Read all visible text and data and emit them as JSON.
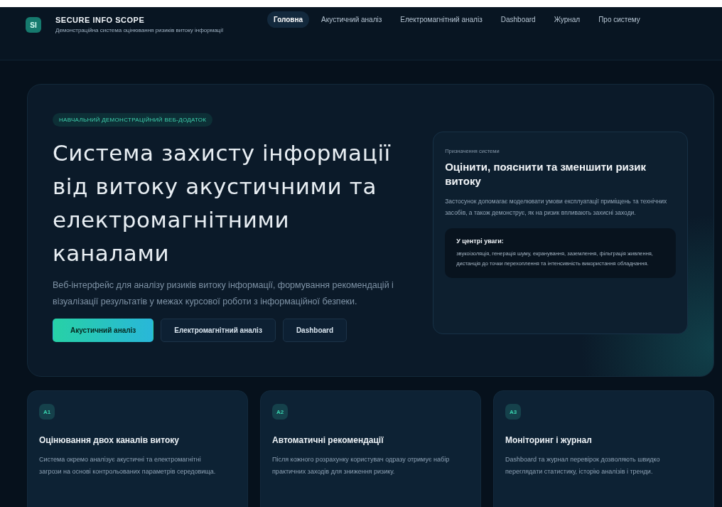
{
  "header": {
    "logo": "SI",
    "title": "SECURE INFO SCOPE",
    "subtitle": "Демонстраційна система оцінювання ризиків витоку інформації"
  },
  "nav": [
    {
      "label": "Головна",
      "selected": true
    },
    {
      "label": "Акустичний аналіз",
      "selected": false
    },
    {
      "label": "Електромагнітний аналіз",
      "selected": false
    },
    {
      "label": "Dashboard",
      "selected": false
    },
    {
      "label": "Журнал",
      "selected": false
    },
    {
      "label": "Про систему",
      "selected": false
    }
  ],
  "hero": {
    "badge": "НАВЧАЛЬНИЙ ДЕМОНСТРАЦІЙНИЙ ВЕБ-ДОДАТОК",
    "title": "Система захисту інформації від витоку акустичними та електромагнітними каналами",
    "description": "Веб-інтерфейс для аналізу ризиків витоку інформації, формування рекомендацій і візуалізації результатів у межах курсової роботи з інформаційної безпеки.",
    "buttons": [
      {
        "label": "Акустичний аналіз",
        "kind": "primary"
      },
      {
        "label": "Електромагнітний аналіз",
        "kind": "secondary"
      },
      {
        "label": "Dashboard",
        "kind": "secondary"
      }
    ]
  },
  "purpose_card": {
    "eyebrow": "Призначення системи",
    "title": "Оцінити, пояснити та зменшити ризик витоку",
    "text": "Застосунок допомагає моделювати умови експлуатації приміщень та технічних засобів, а також демонструє, як на ризик впливають захисні заходи.",
    "focus_title": "У центрі уваги:",
    "focus_text": "звукоізоляція, генерація шуму, екранування, заземлення, фільтрація живлення, дистанція до точки перехоплення та інтенсивність використання обладнання."
  },
  "features": [
    {
      "badge": "A1",
      "title": "Оцінювання двох каналів витоку",
      "text": "Система окремо аналізує акустичні та електромагнітні загрози на основі контрольованих параметрів середовища."
    },
    {
      "badge": "A2",
      "title": "Автоматичні рекомендації",
      "text": "Після кожного розрахунку користувач одразу отримує набір практичних заходів для зниження ризику."
    },
    {
      "badge": "A3",
      "title": "Моніторинг і журнал",
      "text": "Dashboard та журнал перевірок дозволяють швидко переглядати статистику, історію аналізів і тренди."
    }
  ]
}
